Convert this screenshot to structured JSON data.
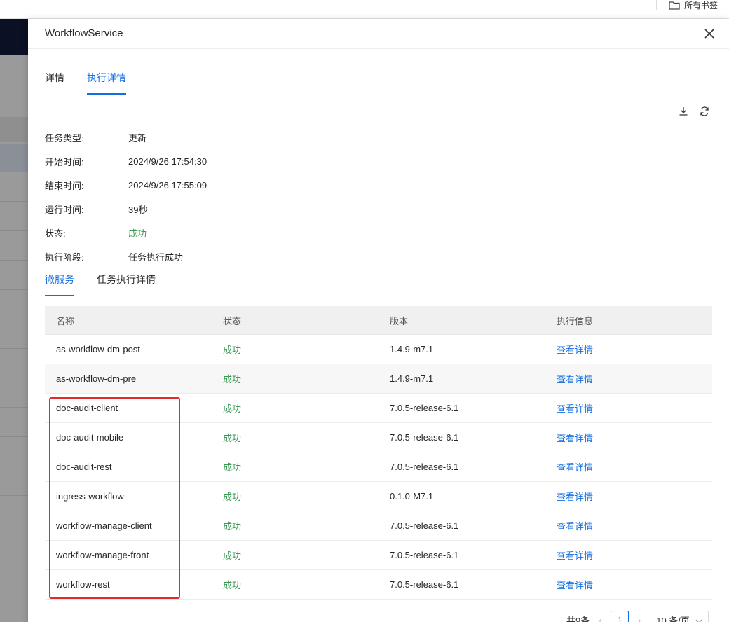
{
  "bookmarks": {
    "all_bookmarks_label": "所有书签"
  },
  "drawer": {
    "title": "WorkflowService",
    "tabs": [
      {
        "label": "详情",
        "active": false
      },
      {
        "label": "执行详情",
        "active": true
      }
    ],
    "info": [
      {
        "key": "任务类型:",
        "value": "更新"
      },
      {
        "key": "开始时间:",
        "value": "2024/9/26 17:54:30"
      },
      {
        "key": "结束时间:",
        "value": "2024/9/26 17:55:09"
      },
      {
        "key": "运行时间:",
        "value": "39秒"
      },
      {
        "key": "状态:",
        "value": "成功"
      },
      {
        "key": "执行阶段:",
        "value": "任务执行成功"
      }
    ],
    "subtabs": [
      {
        "label": "微服务",
        "active": true
      },
      {
        "label": "任务执行详情",
        "active": false
      }
    ],
    "table": {
      "headers": [
        "名称",
        "状态",
        "版本",
        "执行信息"
      ],
      "rows": [
        {
          "name": "as-workflow-dm-post",
          "status": "成功",
          "version": "1.4.9-m7.1",
          "action": "查看详情"
        },
        {
          "name": "as-workflow-dm-pre",
          "status": "成功",
          "version": "1.4.9-m7.1",
          "action": "查看详情"
        },
        {
          "name": "doc-audit-client",
          "status": "成功",
          "version": "7.0.5-release-6.1",
          "action": "查看详情"
        },
        {
          "name": "doc-audit-mobile",
          "status": "成功",
          "version": "7.0.5-release-6.1",
          "action": "查看详情"
        },
        {
          "name": "doc-audit-rest",
          "status": "成功",
          "version": "7.0.5-release-6.1",
          "action": "查看详情"
        },
        {
          "name": "ingress-workflow",
          "status": "成功",
          "version": "0.1.0-M7.1",
          "action": "查看详情"
        },
        {
          "name": "workflow-manage-client",
          "status": "成功",
          "version": "7.0.5-release-6.1",
          "action": "查看详情"
        },
        {
          "name": "workflow-manage-front",
          "status": "成功",
          "version": "7.0.5-release-6.1",
          "action": "查看详情"
        },
        {
          "name": "workflow-rest",
          "status": "成功",
          "version": "7.0.5-release-6.1",
          "action": "查看详情"
        }
      ]
    },
    "pagination": {
      "total": "共9条",
      "current_page": "1",
      "page_size": "10 条/页"
    }
  },
  "colors": {
    "accent": "#126ee3",
    "success": "#3a9a55",
    "highlight": "#e32a2a"
  }
}
